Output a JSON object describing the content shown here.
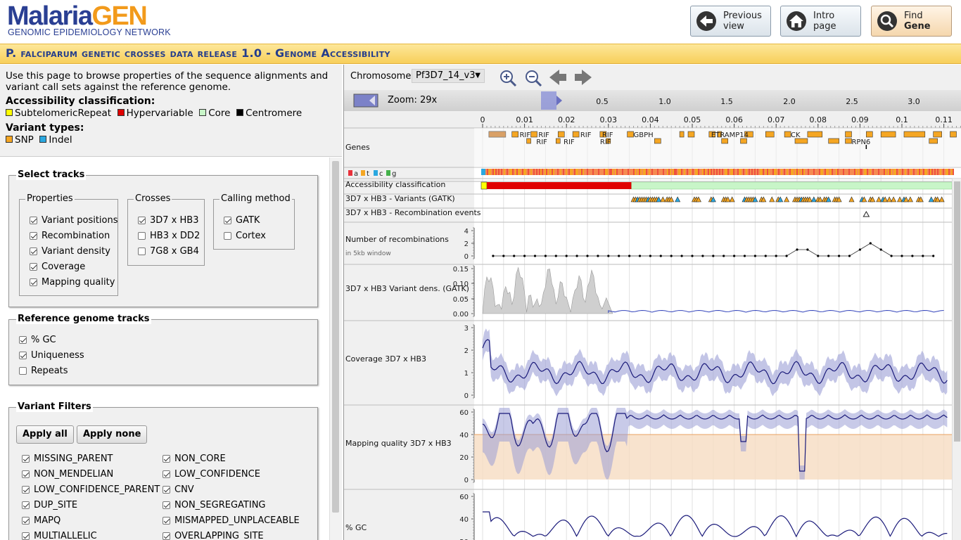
{
  "header": {
    "logo_main_a": "Malaria",
    "logo_main_b": "GEN",
    "logo_sub": "GENOMIC EPIDEMIOLOGY NETWORK",
    "buttons": [
      {
        "line1": "Previous",
        "line2": "view",
        "icon": "back-arrow-icon"
      },
      {
        "line1": "Intro",
        "line2": "page",
        "icon": "home-icon"
      },
      {
        "line1": "Find",
        "line2": "Gene",
        "icon": "magnifier-icon"
      }
    ]
  },
  "title": "P. falciparum genetic crosses data release 1.0 - Genome Accessibility",
  "intro": {
    "description": "Use this page to browse properties of the sequence alignments and variant call sets against the reference genome.",
    "access_heading": "Accessibility classification",
    "access_legend": [
      {
        "label": "SubtelomericRepeat",
        "color": "#ffff00"
      },
      {
        "label": "Hypervariable",
        "color": "#e00000"
      },
      {
        "label": "Core",
        "color": "#c8f5c8"
      },
      {
        "label": "Centromere",
        "color": "#000000"
      }
    ],
    "variant_heading": "Variant types",
    "variant_legend": [
      {
        "label": "SNP",
        "color": "#f5a623"
      },
      {
        "label": "Indel",
        "color": "#2aa8e0"
      }
    ]
  },
  "select_tracks": {
    "title": "Select tracks",
    "properties": {
      "title": "Properties",
      "items": [
        {
          "label": "Variant positions",
          "checked": true
        },
        {
          "label": "Recombination",
          "checked": true
        },
        {
          "label": "Variant density",
          "checked": true
        },
        {
          "label": "Coverage",
          "checked": true
        },
        {
          "label": "Mapping quality",
          "checked": true
        }
      ]
    },
    "crosses": {
      "title": "Crosses",
      "items": [
        {
          "label": "3D7 x HB3",
          "checked": true
        },
        {
          "label": "HB3 x DD2",
          "checked": false
        },
        {
          "label": "7G8 x GB4",
          "checked": false
        }
      ]
    },
    "calling": {
      "title": "Calling method",
      "items": [
        {
          "label": "GATK",
          "checked": true
        },
        {
          "label": "Cortex",
          "checked": false
        }
      ]
    }
  },
  "reference_tracks": {
    "title": "Reference genome tracks",
    "items": [
      {
        "label": "% GC",
        "checked": true
      },
      {
        "label": "Uniqueness",
        "checked": true
      },
      {
        "label": "Repeats",
        "checked": false
      }
    ]
  },
  "variant_filters": {
    "title": "Variant Filters",
    "apply_all": "Apply all",
    "apply_none": "Apply none",
    "items": [
      {
        "label": "MISSING_PARENT",
        "checked": true
      },
      {
        "label": "NON_CORE",
        "checked": true
      },
      {
        "label": "NON_MENDELIAN",
        "checked": true
      },
      {
        "label": "LOW_CONFIDENCE",
        "checked": true
      },
      {
        "label": "LOW_CONFIDENCE_PARENT",
        "checked": true
      },
      {
        "label": "CNV",
        "checked": true
      },
      {
        "label": "DUP_SITE",
        "checked": true
      },
      {
        "label": "NON_SEGREGATING",
        "checked": true
      },
      {
        "label": "MAPQ",
        "checked": true
      },
      {
        "label": "MISMAPPED_UNPLACEABLE",
        "checked": true
      },
      {
        "label": "MULTIALLELIC",
        "checked": true
      },
      {
        "label": "OVERLAPPING_SITE",
        "checked": true
      }
    ]
  },
  "browser": {
    "chromosome_label": "Chromosome:",
    "chromosome_value": "Pf3D7_14_v3",
    "zoom_label": "Zoom: 29x",
    "overview_ticks": [
      "0.5",
      "1.0",
      "1.5",
      "2.0",
      "2.5",
      "3.0"
    ],
    "axis_ticks": [
      "0",
      "0.01",
      "0.02",
      "0.03",
      "0.04",
      "0.05",
      "0.06",
      "0.07",
      "0.08",
      "0.09",
      "0.1",
      "0.11"
    ],
    "tracks": {
      "genes": "Genes",
      "bases": [
        "a",
        "t",
        "c",
        "g"
      ],
      "access": "Accessibility classification",
      "variants": "3D7 x HB3 - Variants (GATK)",
      "recomb_events": "3D7 x HB3 - Recombination events",
      "recomb_num": "Number of recombinations",
      "recomb_num_sub": "in 5kb window",
      "vardens": "3D7 x HB3 Variant dens. (GATK)",
      "coverage": "Coverage 3D7 x HB3",
      "mapq": "Mapping quality 3D7 x HB3",
      "gc": "% GC"
    },
    "gene_labels": [
      "RIF",
      "RIF",
      "RIF",
      "RIF",
      "RIF",
      "RIF",
      "RIF",
      "GBPH",
      "ETRAMP14",
      "CK",
      "RPN6"
    ],
    "recomb_ticks": [
      "4",
      "2",
      "0"
    ],
    "vardens_ticks": [
      "0.15",
      "0.10",
      "0.05",
      "0.00"
    ],
    "coverage_ticks": [
      "3",
      "2",
      "1",
      "0"
    ],
    "mapq_ticks": [
      "60",
      "40",
      "20",
      "0"
    ],
    "gc_ticks": [
      "60",
      "40",
      "20"
    ]
  }
}
